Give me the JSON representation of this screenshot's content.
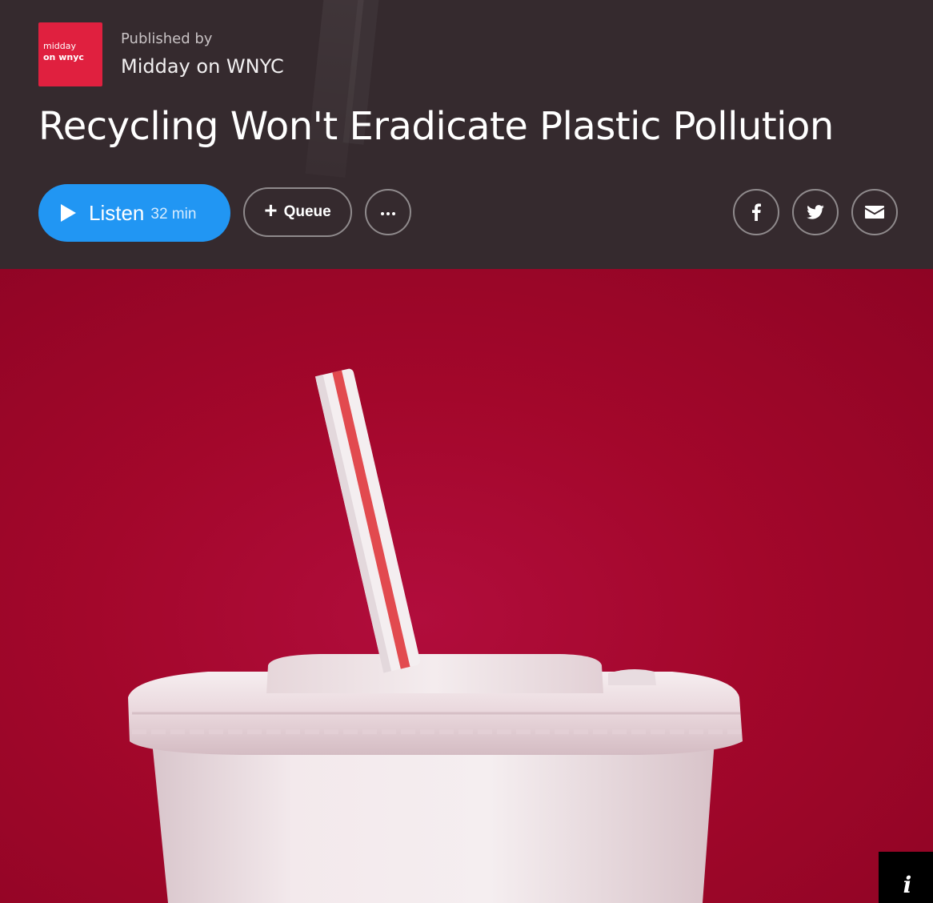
{
  "publisher": {
    "logo_line1": "midday",
    "logo_line2": "on wnyc",
    "published_label": "Published by",
    "name": "Midday on WNYC"
  },
  "episode": {
    "title": "Recycling Won't Eradicate Plastic Pollution"
  },
  "actions": {
    "listen_label": "Listen",
    "listen_duration": "32 min",
    "queue_label": "Queue",
    "more_icon": "ellipsis-icon"
  },
  "share": {
    "facebook_icon": "facebook-icon",
    "twitter_icon": "twitter-icon",
    "email_icon": "email-icon"
  },
  "hero_image": {
    "info_glyph": "i"
  },
  "colors": {
    "header_bg": "#352a2e",
    "listen_button": "#2196f3",
    "logo_bg": "#e0203f",
    "hero_bg": "#a3072b"
  }
}
